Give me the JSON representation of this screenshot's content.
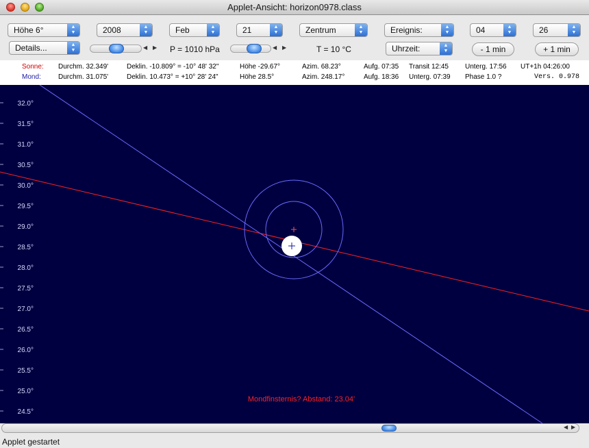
{
  "window": {
    "title": "Applet-Ansicht: horizon0978.class"
  },
  "controls": {
    "hoehe": "Höhe 6°",
    "year": "2008",
    "month": "Feb",
    "day": "21",
    "mode": "Zentrum",
    "event": "Ereignis:",
    "hour": "04",
    "minute": "26",
    "details": "Details...",
    "pressure": "P = 1010 hPa",
    "temperature": "T = 10 °C",
    "time_select": "Uhrzeit:",
    "minus_min": "- 1 min",
    "plus_min": "+ 1 min"
  },
  "info": {
    "sun": {
      "name": "Sonne:",
      "diameter": "Durchm. 32.349'",
      "declination": "Deklin. -10.809° = -10° 48' 32\"",
      "altitude": "Höhe -29.67°",
      "azimuth": "Azim. 68.23°",
      "rise": "Aufg. 07:35",
      "transit": "Transit 12:45",
      "set": "Unterg. 17:56",
      "ut": "UT+1h  04:26:00"
    },
    "moon": {
      "name": "Mond:",
      "diameter": "Durchm. 31.075'",
      "declination": "Deklin. 10.473° = +10° 28' 24\"",
      "altitude": "Höhe 28.5°",
      "azimuth": "Azim. 248.17°",
      "rise": "Aufg. 18:36",
      "set": "Unterg. 07:39",
      "phase": "Phase 1.0 ?",
      "version": "Vers. 0.978"
    }
  },
  "sky": {
    "y_ticks": [
      "32.0°",
      "31.5°",
      "31.0°",
      "30.5°",
      "30.0°",
      "29.5°",
      "29.0°",
      "28.5°",
      "28.0°",
      "27.5°",
      "27.0°",
      "26.5°",
      "26.0°",
      "25.5°",
      "25.0°",
      "24.5°"
    ],
    "eclipse_text": "Mondfinsternis? Abstand: 23.04'",
    "colors": {
      "background": "#000040",
      "ecliptic": "#ff2020",
      "moon_path": "#6a6aff",
      "moon": "#ffffff"
    }
  },
  "status": {
    "text": "Applet gestartet"
  }
}
